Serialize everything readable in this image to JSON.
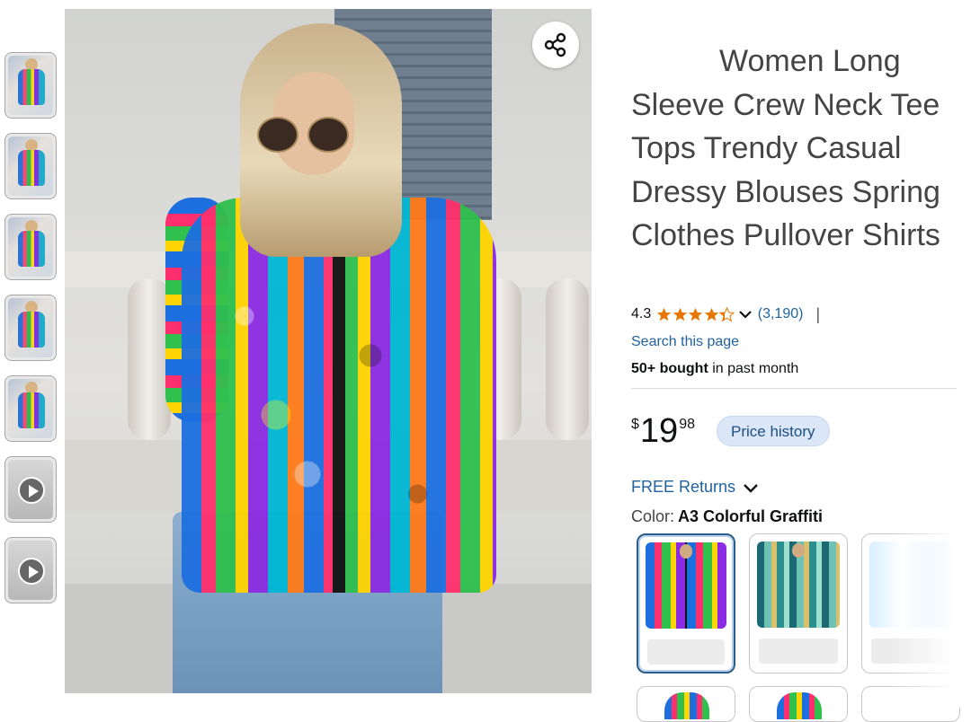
{
  "product": {
    "title": "Women Long Sleeve Crew Neck Tee Tops Trendy Casual Dressy Blouses Spring Clothes Pullover Shirts"
  },
  "rating": {
    "value": "4.3",
    "stars": 4.3,
    "max_stars": 5,
    "count": "(3,190)",
    "separator": "|"
  },
  "links": {
    "search_page": "Search this page"
  },
  "social_proof": {
    "bold": "50+ bought",
    "rest": " in past month"
  },
  "price": {
    "currency": "$",
    "whole": "19",
    "fraction": "98",
    "history_label": "Price history"
  },
  "returns": {
    "label": "FREE Returns"
  },
  "color": {
    "label": "Color:",
    "selected": "A3 Colorful Graffiti",
    "swatch_count_visible": 3
  },
  "icons": {
    "share": "share-icon",
    "star": "star-icon",
    "chevron": "chevron-down-icon",
    "play": "play-icon"
  },
  "colors": {
    "link": "#2162a1",
    "star": "#e77600",
    "price_history_bg": "#dbe7f6",
    "selected_border": "#2a5d8e"
  }
}
